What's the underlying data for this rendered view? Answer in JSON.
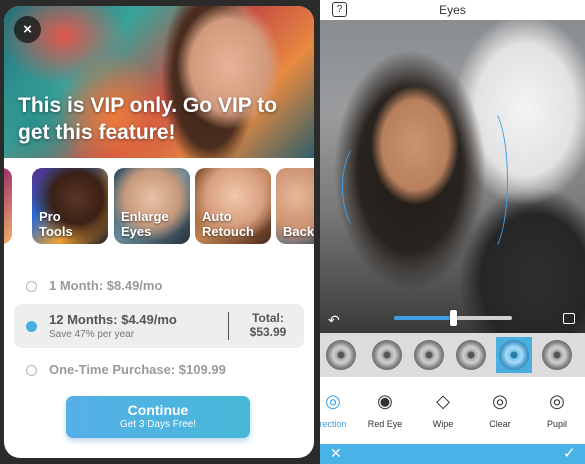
{
  "vip": {
    "close_icon": "×",
    "title": "This is VIP only. Go VIP to get this feature!",
    "features": [
      {
        "label": "g"
      },
      {
        "label": "Pro\nTools"
      },
      {
        "label": "Enlarge\nEyes"
      },
      {
        "label": "Auto\nRetouch"
      },
      {
        "label": "Back"
      }
    ],
    "plans": {
      "monthly": "1 Month: $8.49/mo",
      "yearly": "12 Months: $4.49/mo",
      "yearly_sub": "Save 47% per year",
      "total_label": "Total:",
      "total_value": "$53.99",
      "one_time": "One-Time Purchase: $109.99"
    },
    "continue": {
      "label": "Continue",
      "sub": "Get 3 Days Free!"
    },
    "accent": "#4aaee0"
  },
  "editor": {
    "help_icon": "?",
    "title": "Eyes",
    "undo_icon": "↶",
    "slider_level": 0.5,
    "tools": [
      {
        "label": "rection",
        "icon": "◎",
        "active": true
      },
      {
        "label": "Red Eye",
        "icon": "◉"
      },
      {
        "label": "Wipe",
        "icon": "◇"
      },
      {
        "label": "Clear",
        "icon": "◎"
      },
      {
        "label": "Pupil",
        "icon": "◎"
      }
    ],
    "cancel_icon": "✕",
    "apply_icon": "✓",
    "accent": "#49b2e6"
  }
}
